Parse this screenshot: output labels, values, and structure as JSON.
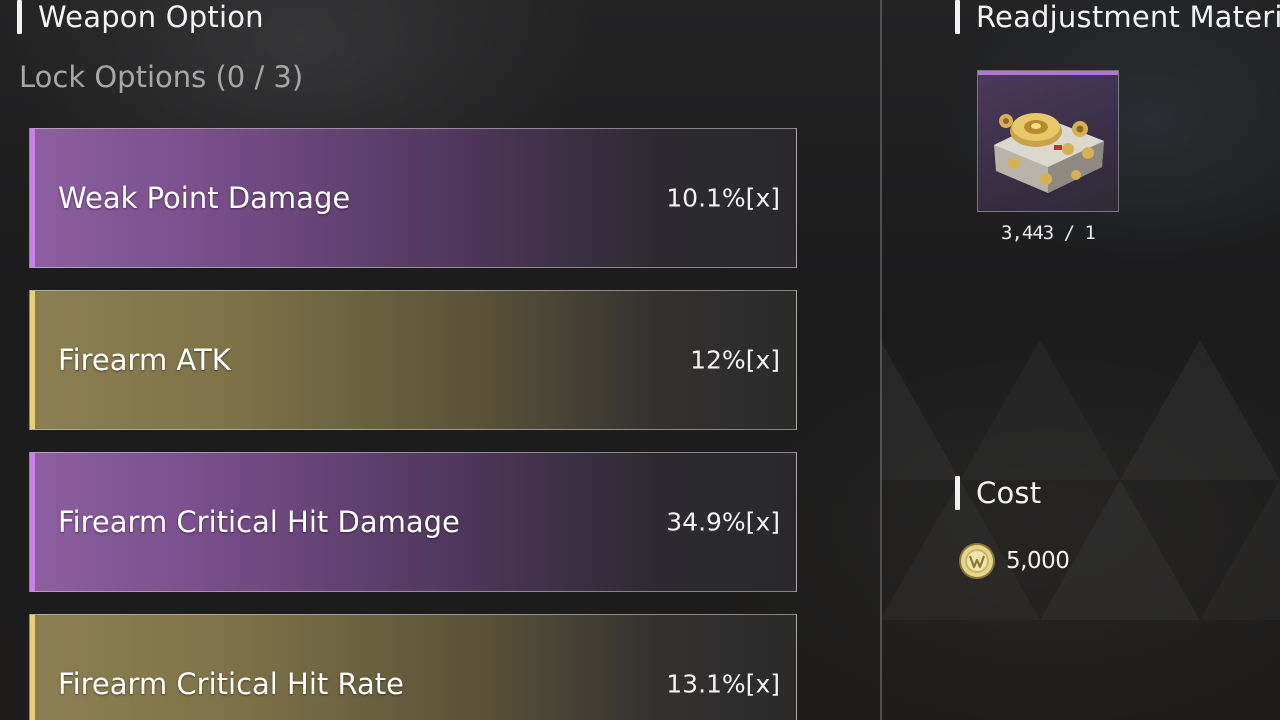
{
  "weapon_option": {
    "title": "Weapon Option",
    "lock_label": "Lock Options (0 / 3)",
    "options": [
      {
        "name": "Weak Point Damage",
        "value": "10.1%[x]",
        "tier": "purple"
      },
      {
        "name": "Firearm ATK",
        "value": "12%[x]",
        "tier": "gold"
      },
      {
        "name": "Firearm Critical Hit Damage",
        "value": "34.9%[x]",
        "tier": "purple"
      },
      {
        "name": "Firearm Critical Hit Rate",
        "value": "13.1%[x]",
        "tier": "gold"
      }
    ]
  },
  "materials": {
    "title": "Readjustment Materi",
    "items": [
      {
        "icon": "gear-component-icon",
        "count": "3,443 / 1",
        "rarity_color": "#b474e0"
      }
    ]
  },
  "cost": {
    "title": "Cost",
    "icon": "gold-coin-icon",
    "value": "5,000"
  },
  "colors": {
    "purple_tier": "#c97ff0",
    "gold_tier": "#e9cf72",
    "background": "#1a1a1b"
  }
}
